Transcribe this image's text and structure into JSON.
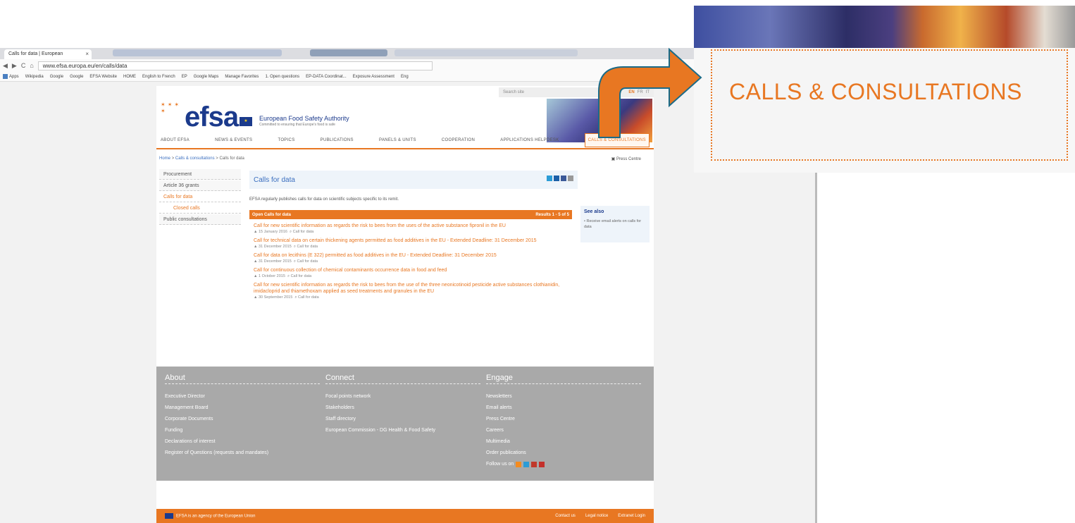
{
  "browser": {
    "tab_title": "Calls for data | European",
    "tab_close": "×",
    "url": "www.efsa.europa.eu/en/calls/data",
    "bookmarks": [
      "Apps",
      "Wikipedia",
      "Google",
      "Google",
      "EFSA Website",
      "HOME",
      "English to French",
      "EP",
      "Google Maps",
      "Manage Favorites",
      "1. Open questions",
      "EP-DATA Coordinat...",
      "Exposure Assessment",
      "Eng"
    ]
  },
  "site": {
    "search_placeholder": "Search site",
    "languages": [
      "EN",
      "FR",
      "IT"
    ],
    "logo": "efsa",
    "agency_name": "European Food Safety Authority",
    "tagline": "Committed to ensuring that Europe's food is safe",
    "nav": [
      "ABOUT EFSA",
      "NEWS & EVENTS",
      "TOPICS",
      "PUBLICATIONS",
      "PANELS & UNITS",
      "COOPERATION",
      "APPLICATIONS HELPDESK",
      "CALLS & CONSULTATIONS"
    ],
    "breadcrumb": {
      "home": "Home",
      "sep": ">",
      "section": "Calls & consultations",
      "current": "Calls for data"
    },
    "press_centre": "Press Centre",
    "left_nav": [
      "Procurement",
      "Article 36 grants",
      "Calls for data",
      "Closed calls",
      "Public consultations"
    ],
    "page_title": "Calls for data",
    "intro": "EFSA regularly publishes calls for data on scientific subjects specific to its remit.",
    "open_calls_label": "Open Calls for data",
    "results_label": "Results 1 - 5 of 5",
    "calls": [
      {
        "title": "Call for new scientific information as regards the risk to bees from the uses of the active substance fipronil in the EU",
        "date": "15 January 2016",
        "type": "Call for data"
      },
      {
        "title": "Call for technical data on certain thickening agents permitted as food additives in the EU - Extended Deadline: 31 December 2015",
        "date": "31 December 2015",
        "type": "Call for data"
      },
      {
        "title": "Call for data on lecithins (E 322) permitted as food additives in the EU - Extended Deadline: 31 December 2015",
        "date": "31 December 2015",
        "type": "Call for data"
      },
      {
        "title": "Call for continuous collection of chemical contaminants occurrence data in food and feed",
        "date": "1 October 2015",
        "type": "Call for data"
      },
      {
        "title": "Call for new scientific information as regards the risk to bees from the use of the three neonicotinoid pesticide active substances clothianidin, imidacloprid and thiamethoxam applied as seed treatments and granules in the EU",
        "date": "30 September 2015",
        "type": "Call for data"
      }
    ],
    "see_also_title": "See also",
    "see_also_item": "Receive email alerts on calls for data",
    "footer": {
      "about": {
        "title": "About",
        "items": [
          "Executive Director",
          "Management Board",
          "Corporate Documents",
          "Funding",
          "Declarations of interest",
          "Register of Questions (requests and mandates)"
        ]
      },
      "connect": {
        "title": "Connect",
        "items": [
          "Focal points network",
          "Stakeholders",
          "Staff directory",
          "European Commission - DG Health & Food Safety"
        ]
      },
      "engage": {
        "title": "Engage",
        "items": [
          "Newsletters",
          "Email alerts",
          "Press Centre",
          "Careers",
          "Multimedia",
          "Order publications"
        ],
        "follow": "Follow us on"
      }
    },
    "bottom_bar": {
      "agency": "EFSA is an agency of the European Union",
      "links": [
        "Contact us",
        "Legal notice",
        "Extranet Login"
      ]
    }
  },
  "callout": {
    "text": "CALLS & CONSULTATIONS",
    "arrow_color": "#e87722"
  },
  "colors": {
    "accent": "#e87722",
    "brand": "#1b3a8c",
    "link": "#3a6ebf",
    "footer_bg": "#a9a9a9"
  }
}
